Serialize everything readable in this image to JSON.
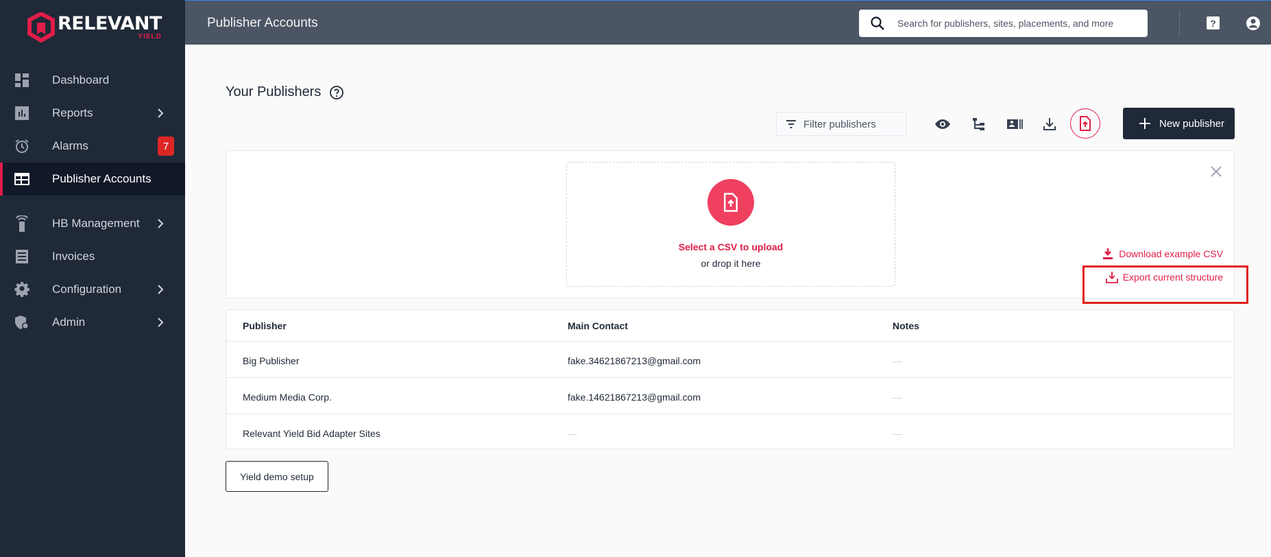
{
  "brand": {
    "name": "RELEVANT",
    "sub": "YIELD",
    "accent": "#e11d48"
  },
  "sidebar": {
    "items": [
      {
        "label": "Dashboard",
        "icon": "dashboard-icon"
      },
      {
        "label": "Reports",
        "icon": "bar-chart-icon",
        "chevron": true
      },
      {
        "label": "Alarms",
        "icon": "alarm-icon",
        "badge": "7"
      },
      {
        "label": "Publisher Accounts",
        "icon": "table-icon",
        "active": true
      },
      {
        "label": "HB Management",
        "icon": "remote-icon",
        "chevron": true
      },
      {
        "label": "Invoices",
        "icon": "receipt-icon"
      },
      {
        "label": "Configuration",
        "icon": "gear-icon",
        "chevron": true
      },
      {
        "label": "Admin",
        "icon": "admin-shield-icon",
        "chevron": true
      }
    ]
  },
  "header": {
    "title": "Publisher Accounts",
    "search_placeholder": "Search for publishers, sites, placements, and more",
    "help_label": "?"
  },
  "main": {
    "heading": "Your Publishers",
    "filter_placeholder": "Filter publishers",
    "new_publisher_label": "New publisher",
    "upload": {
      "select_label": "Select a CSV to upload",
      "drop_label": "or drop it here",
      "download_example_label": "Download example CSV",
      "export_structure_label": "Export current structure"
    },
    "table": {
      "columns": [
        "Publisher",
        "Main Contact",
        "Notes"
      ],
      "rows": [
        {
          "publisher": "Big Publisher",
          "contact": "fake.34621867213@gmail.com",
          "notes": "—"
        },
        {
          "publisher": "Medium Media Corp.",
          "contact": "fake.14621867213@gmail.com",
          "notes": "—"
        },
        {
          "publisher": "Relevant Yield Bid Adapter Sites",
          "contact": "—",
          "notes": "—"
        }
      ]
    },
    "demo_button_label": "Yield demo setup"
  }
}
